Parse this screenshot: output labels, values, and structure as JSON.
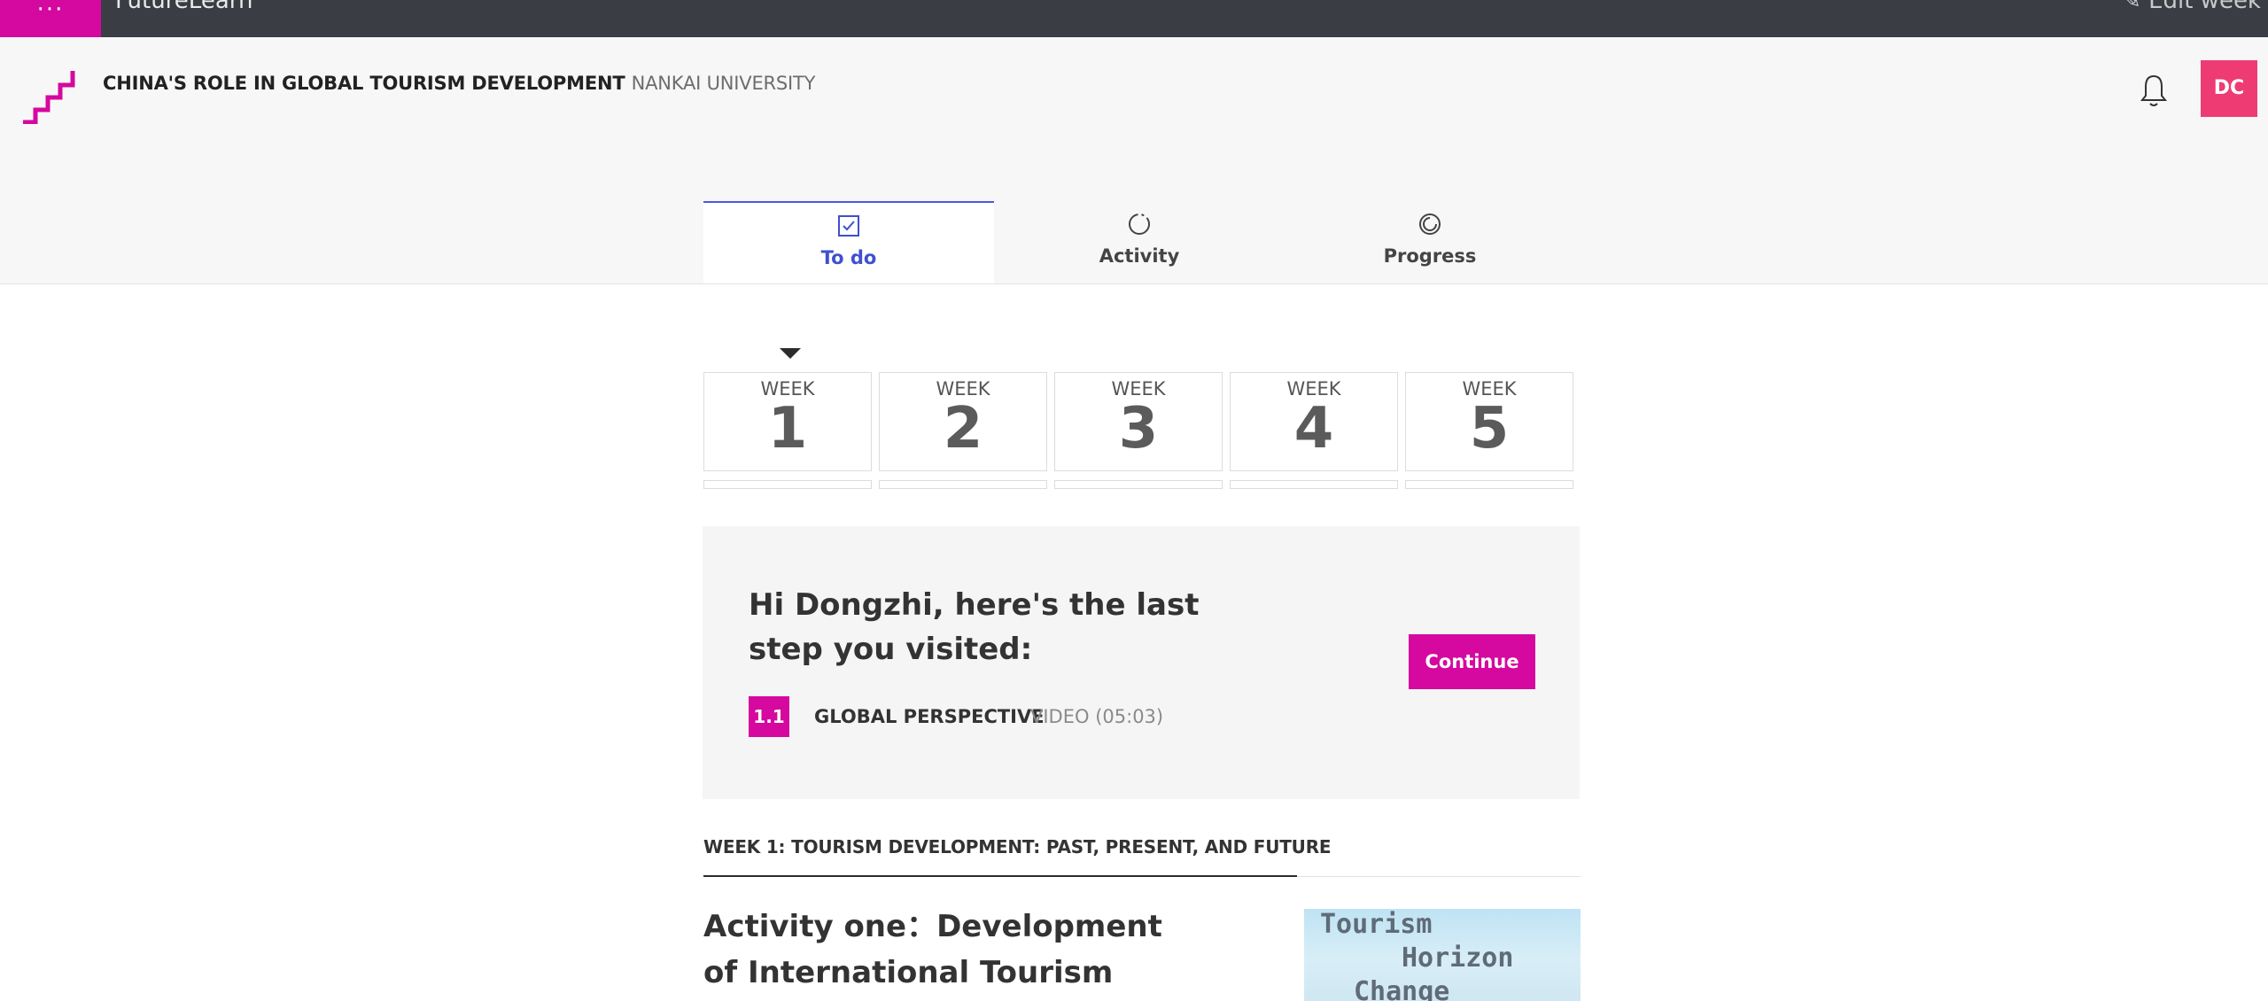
{
  "topbar": {
    "menu_glyph": "···",
    "brand": "FutureLearn",
    "edit_week": "✎ Edit week"
  },
  "header": {
    "course_title": "CHINA'S ROLE IN GLOBAL TOURISM DEVELOPMENT",
    "university": "NANKAI UNIVERSITY",
    "avatar_initials": "DC"
  },
  "tabs": [
    {
      "label": "To do",
      "icon": "checkbox-icon",
      "active": true
    },
    {
      "label": "Activity",
      "icon": "activity-ring-icon",
      "active": false
    },
    {
      "label": "Progress",
      "icon": "progress-ring-icon",
      "active": false
    }
  ],
  "weeks": [
    {
      "label": "WEEK",
      "number": "1"
    },
    {
      "label": "WEEK",
      "number": "2"
    },
    {
      "label": "WEEK",
      "number": "3"
    },
    {
      "label": "WEEK",
      "number": "4"
    },
    {
      "label": "WEEK",
      "number": "5"
    }
  ],
  "resume": {
    "greeting": "Hi Dongzhi, here's the last step you visited:",
    "step_number": "1.1",
    "step_title": "GLOBAL PERSPECTIVE",
    "step_meta": "VIDEO (05:03)",
    "continue_label": "Continue"
  },
  "week_section": {
    "heading": "WEEK 1: TOURISM DEVELOPMENT: PAST, PRESENT, AND FUTURE",
    "activity_title": "Activity one：Development of International Tourism",
    "thumbnail_text": [
      "Tourism",
      "Horizon",
      "Change"
    ]
  },
  "colors": {
    "brand_magenta": "#d5089f",
    "tab_active": "#3f50cf",
    "avatar": "#ee3b74",
    "topbar": "#3a3d44"
  }
}
